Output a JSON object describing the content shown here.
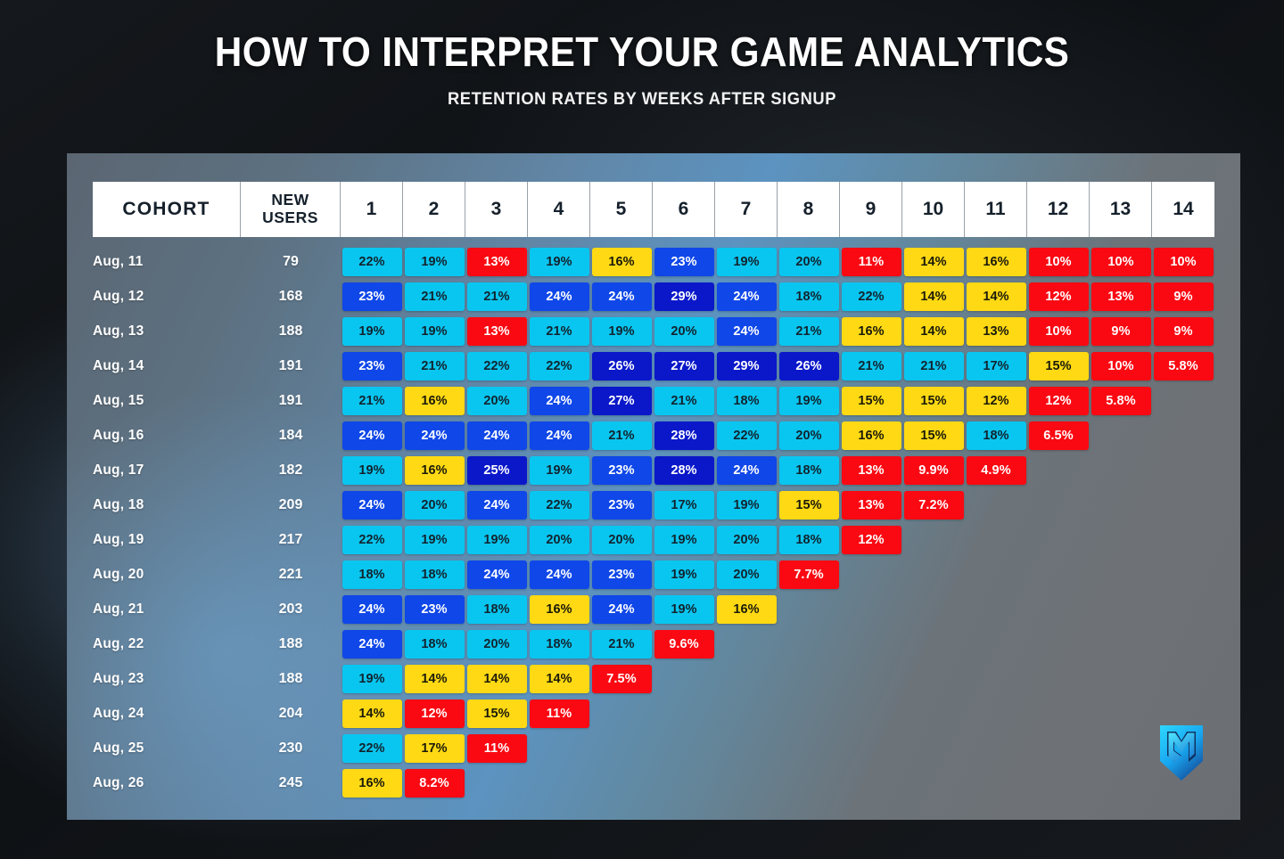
{
  "header": {
    "title": "HOW TO INTERPRET YOUR GAME ANALYTICS",
    "subtitle": "RETENTION RATES BY WEEKS AFTER SIGNUP"
  },
  "logo": {
    "name": "ms-shield-logo",
    "alt": "MS shield monogram logo"
  },
  "palette": {
    "cyan": "#09C6F0",
    "blue": "#0F47E8",
    "dark_blue": "#0A18C9",
    "yellow": "#FFD913",
    "red": "#FA0912",
    "panel_left": "#5C93C0",
    "panel_right": "#6E7276",
    "page_background": "#111418"
  },
  "chart_data": {
    "type": "heatmap",
    "title": "HOW TO INTERPRET YOUR GAME ANALYTICS",
    "subtitle": "RETENTION RATES BY WEEKS AFTER SIGNUP",
    "xlabel": "Weeks after signup",
    "ylabel": "Cohort",
    "columns": [
      "COHORT",
      "NEW USERS",
      "1",
      "2",
      "3",
      "4",
      "5",
      "6",
      "7",
      "8",
      "9",
      "10",
      "11",
      "12",
      "13",
      "14"
    ],
    "week_labels": [
      "1",
      "2",
      "3",
      "4",
      "5",
      "6",
      "7",
      "8",
      "9",
      "10",
      "11",
      "12",
      "13",
      "14"
    ],
    "color_scale": {
      "dark_blue": "25% and above",
      "blue": "22% to 24%",
      "cyan": "17% to 21%",
      "yellow": "14% to 16%",
      "red": "13% and below"
    },
    "rows": [
      {
        "cohort": "Aug, 11",
        "new_users": 79,
        "values": [
          "22%",
          "19%",
          "13%",
          "19%",
          "16%",
          "23%",
          "19%",
          "20%",
          "11%",
          "14%",
          "16%",
          "10%",
          "10%",
          "10%"
        ],
        "levels": [
          "cyan",
          "cyan",
          "red",
          "cyan",
          "yellow",
          "blue",
          "cyan",
          "cyan",
          "red",
          "yellow",
          "yellow",
          "red",
          "red",
          "red"
        ]
      },
      {
        "cohort": "Aug, 12",
        "new_users": 168,
        "values": [
          "23%",
          "21%",
          "21%",
          "24%",
          "24%",
          "29%",
          "24%",
          "18%",
          "22%",
          "14%",
          "14%",
          "12%",
          "13%",
          "9%"
        ],
        "levels": [
          "blue",
          "cyan",
          "cyan",
          "blue",
          "blue",
          "dark_blue",
          "blue",
          "cyan",
          "cyan",
          "yellow",
          "yellow",
          "red",
          "red",
          "red"
        ]
      },
      {
        "cohort": "Aug, 13",
        "new_users": 188,
        "values": [
          "19%",
          "19%",
          "13%",
          "21%",
          "19%",
          "20%",
          "24%",
          "21%",
          "16%",
          "14%",
          "13%",
          "10%",
          "9%",
          "9%"
        ],
        "levels": [
          "cyan",
          "cyan",
          "red",
          "cyan",
          "cyan",
          "cyan",
          "blue",
          "cyan",
          "yellow",
          "yellow",
          "yellow",
          "red",
          "red",
          "red"
        ]
      },
      {
        "cohort": "Aug, 14",
        "new_users": 191,
        "values": [
          "23%",
          "21%",
          "22%",
          "22%",
          "26%",
          "27%",
          "29%",
          "26%",
          "21%",
          "21%",
          "17%",
          "15%",
          "10%",
          "5.8%"
        ],
        "levels": [
          "blue",
          "cyan",
          "cyan",
          "cyan",
          "dark_blue",
          "dark_blue",
          "dark_blue",
          "dark_blue",
          "cyan",
          "cyan",
          "cyan",
          "yellow",
          "red",
          "red"
        ]
      },
      {
        "cohort": "Aug, 15",
        "new_users": 191,
        "values": [
          "21%",
          "16%",
          "20%",
          "24%",
          "27%",
          "21%",
          "18%",
          "19%",
          "15%",
          "15%",
          "12%",
          "12%",
          "5.8%",
          ""
        ],
        "levels": [
          "cyan",
          "yellow",
          "cyan",
          "blue",
          "dark_blue",
          "cyan",
          "cyan",
          "cyan",
          "yellow",
          "yellow",
          "yellow",
          "red",
          "red",
          "empty"
        ]
      },
      {
        "cohort": "Aug, 16",
        "new_users": 184,
        "values": [
          "24%",
          "24%",
          "24%",
          "24%",
          "21%",
          "28%",
          "22%",
          "20%",
          "16%",
          "15%",
          "18%",
          "6.5%",
          "",
          ""
        ],
        "levels": [
          "blue",
          "blue",
          "blue",
          "blue",
          "cyan",
          "dark_blue",
          "cyan",
          "cyan",
          "yellow",
          "yellow",
          "cyan",
          "red",
          "empty",
          "empty"
        ]
      },
      {
        "cohort": "Aug, 17",
        "new_users": 182,
        "values": [
          "19%",
          "16%",
          "25%",
          "19%",
          "23%",
          "28%",
          "24%",
          "18%",
          "13%",
          "9.9%",
          "4.9%",
          "",
          "",
          ""
        ],
        "levels": [
          "cyan",
          "yellow",
          "dark_blue",
          "cyan",
          "blue",
          "dark_blue",
          "blue",
          "cyan",
          "red",
          "red",
          "red",
          "empty",
          "empty",
          "empty"
        ]
      },
      {
        "cohort": "Aug, 18",
        "new_users": 209,
        "values": [
          "24%",
          "20%",
          "24%",
          "22%",
          "23%",
          "17%",
          "19%",
          "15%",
          "13%",
          "7.2%",
          "",
          "",
          "",
          ""
        ],
        "levels": [
          "blue",
          "cyan",
          "blue",
          "cyan",
          "blue",
          "cyan",
          "cyan",
          "yellow",
          "red",
          "red",
          "empty",
          "empty",
          "empty",
          "empty"
        ]
      },
      {
        "cohort": "Aug, 19",
        "new_users": 217,
        "values": [
          "22%",
          "19%",
          "19%",
          "20%",
          "20%",
          "19%",
          "20%",
          "18%",
          "12%",
          "",
          "",
          "",
          "",
          ""
        ],
        "levels": [
          "cyan",
          "cyan",
          "cyan",
          "cyan",
          "cyan",
          "cyan",
          "cyan",
          "cyan",
          "red",
          "empty",
          "empty",
          "empty",
          "empty",
          "empty"
        ]
      },
      {
        "cohort": "Aug, 20",
        "new_users": 221,
        "values": [
          "18%",
          "18%",
          "24%",
          "24%",
          "23%",
          "19%",
          "20%",
          "7.7%",
          "",
          "",
          "",
          "",
          "",
          ""
        ],
        "levels": [
          "cyan",
          "cyan",
          "blue",
          "blue",
          "blue",
          "cyan",
          "cyan",
          "red",
          "empty",
          "empty",
          "empty",
          "empty",
          "empty",
          "empty"
        ]
      },
      {
        "cohort": "Aug, 21",
        "new_users": 203,
        "values": [
          "24%",
          "23%",
          "18%",
          "16%",
          "24%",
          "19%",
          "16%",
          "",
          "",
          "",
          "",
          "",
          "",
          ""
        ],
        "levels": [
          "blue",
          "blue",
          "cyan",
          "yellow",
          "blue",
          "cyan",
          "yellow",
          "empty",
          "empty",
          "empty",
          "empty",
          "empty",
          "empty",
          "empty"
        ]
      },
      {
        "cohort": "Aug, 22",
        "new_users": 188,
        "values": [
          "24%",
          "18%",
          "20%",
          "18%",
          "21%",
          "9.6%",
          "",
          "",
          "",
          "",
          "",
          "",
          "",
          ""
        ],
        "levels": [
          "blue",
          "cyan",
          "cyan",
          "cyan",
          "cyan",
          "red",
          "empty",
          "empty",
          "empty",
          "empty",
          "empty",
          "empty",
          "empty",
          "empty"
        ]
      },
      {
        "cohort": "Aug, 23",
        "new_users": 188,
        "values": [
          "19%",
          "14%",
          "14%",
          "14%",
          "7.5%",
          "",
          "",
          "",
          "",
          "",
          "",
          "",
          "",
          ""
        ],
        "levels": [
          "cyan",
          "yellow",
          "yellow",
          "yellow",
          "red",
          "empty",
          "empty",
          "empty",
          "empty",
          "empty",
          "empty",
          "empty",
          "empty",
          "empty"
        ]
      },
      {
        "cohort": "Aug, 24",
        "new_users": 204,
        "values": [
          "14%",
          "12%",
          "15%",
          "11%",
          "",
          "",
          "",
          "",
          "",
          "",
          "",
          "",
          "",
          ""
        ],
        "levels": [
          "yellow",
          "red",
          "yellow",
          "red",
          "empty",
          "empty",
          "empty",
          "empty",
          "empty",
          "empty",
          "empty",
          "empty",
          "empty",
          "empty"
        ]
      },
      {
        "cohort": "Aug, 25",
        "new_users": 230,
        "values": [
          "22%",
          "17%",
          "11%",
          "",
          "",
          "",
          "",
          "",
          "",
          "",
          "",
          "",
          "",
          ""
        ],
        "levels": [
          "cyan",
          "yellow",
          "red",
          "empty",
          "empty",
          "empty",
          "empty",
          "empty",
          "empty",
          "empty",
          "empty",
          "empty",
          "empty",
          "empty"
        ]
      },
      {
        "cohort": "Aug, 26",
        "new_users": 245,
        "values": [
          "16%",
          "8.2%",
          "",
          "",
          "",
          "",
          "",
          "",
          "",
          "",
          "",
          "",
          "",
          ""
        ],
        "levels": [
          "yellow",
          "red",
          "empty",
          "empty",
          "empty",
          "empty",
          "empty",
          "empty",
          "empty",
          "empty",
          "empty",
          "empty",
          "empty",
          "empty"
        ]
      }
    ]
  }
}
